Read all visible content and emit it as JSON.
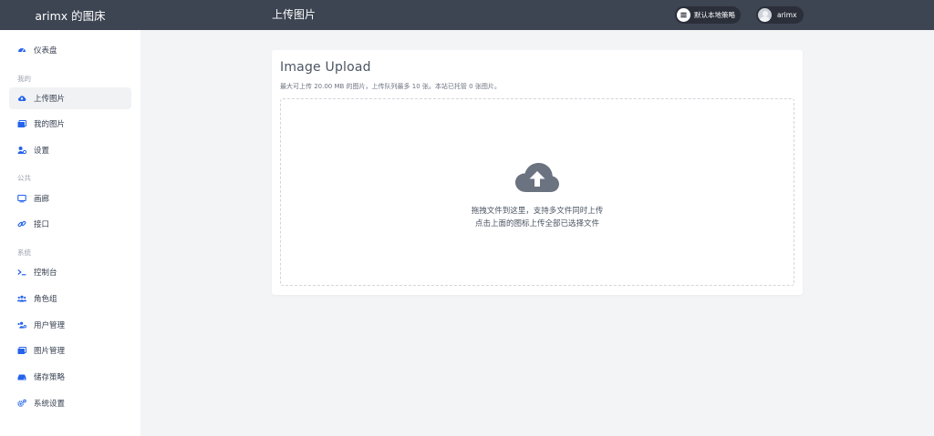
{
  "app": {
    "brand": "arimx 的图床"
  },
  "header": {
    "title": "上传图片",
    "policy_label": "默认本地策略",
    "user_name": "arimx"
  },
  "sidebar": {
    "dashboard": "仪表盘",
    "sections": {
      "mine": "我的",
      "public": "公共",
      "system": "系统"
    },
    "items": {
      "upload": "上传图片",
      "my_images": "我的图片",
      "settings": "设置",
      "gallery": "画廊",
      "api": "接口",
      "console": "控制台",
      "roles": "角色组",
      "users": "用户管理",
      "image_manage": "图片管理",
      "storage": "储存策略",
      "system_settings": "系统设置"
    }
  },
  "upload": {
    "title": "Image Upload",
    "subtitle": "最大可上传 20.00 MB 的图片，上传队列最多 10 张。本站已托管 0 张图片。",
    "hint_line1": "拖拽文件到这里，支持多文件同时上传",
    "hint_line2": "点击上面的图标上传全部已选择文件"
  },
  "colors": {
    "accent": "#2563eb",
    "topbar": "#3d4452",
    "icon_gray": "#6b7280"
  },
  "icons": {
    "dashboard": "gauge-icon",
    "upload": "cloud-upload-icon",
    "my_images": "images-icon",
    "settings": "user-cog-icon",
    "gallery": "monitor-icon",
    "api": "link-icon",
    "console": "terminal-icon",
    "roles": "users-icon",
    "users": "users-cog-icon",
    "image_manage": "images-icon",
    "storage": "hdd-icon",
    "system_settings": "cogs-icon"
  }
}
